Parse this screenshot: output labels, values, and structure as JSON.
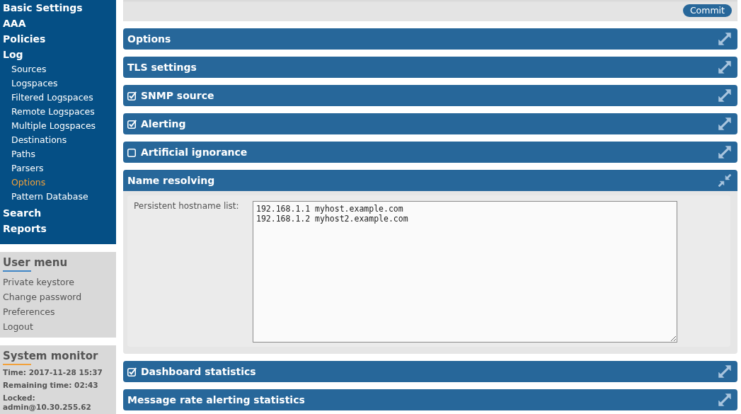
{
  "nav": {
    "items": [
      {
        "label": "Basic Settings",
        "selected": false
      },
      {
        "label": "AAA",
        "selected": false
      },
      {
        "label": "Policies",
        "selected": false
      },
      {
        "label": "Log",
        "selected": false,
        "children": [
          {
            "label": "Sources",
            "selected": false
          },
          {
            "label": "Logspaces",
            "selected": false
          },
          {
            "label": "Filtered Logspaces",
            "selected": false
          },
          {
            "label": "Remote Logspaces",
            "selected": false
          },
          {
            "label": "Multiple Logspaces",
            "selected": false
          },
          {
            "label": "Destinations",
            "selected": false
          },
          {
            "label": "Paths",
            "selected": false
          },
          {
            "label": "Parsers",
            "selected": false
          },
          {
            "label": "Options",
            "selected": true
          },
          {
            "label": "Pattern Database",
            "selected": false
          }
        ]
      },
      {
        "label": "Search",
        "selected": false
      },
      {
        "label": "Reports",
        "selected": false
      }
    ]
  },
  "user_menu": {
    "title": "User menu",
    "items": [
      "Private keystore",
      "Change password",
      "Preferences",
      "Logout"
    ]
  },
  "system_monitor": {
    "title": "System monitor",
    "items": [
      "Time: 2017-11-28 15:37",
      "Remaining time: 02:43",
      "Locked: admin@10.30.255.62"
    ]
  },
  "toolbar": {
    "button": "Commit"
  },
  "sections": [
    {
      "title": "Options",
      "kind": "plain",
      "expanded": false
    },
    {
      "title": "TLS settings",
      "kind": "plain",
      "expanded": false
    },
    {
      "title": "SNMP source",
      "kind": "checkbox",
      "checked": true,
      "expanded": false
    },
    {
      "title": "Alerting",
      "kind": "checkbox",
      "checked": true,
      "expanded": false
    },
    {
      "title": "Artificial ignorance",
      "kind": "checkbox",
      "checked": false,
      "expanded": false
    },
    {
      "title": "Name resolving",
      "kind": "plain",
      "expanded": true,
      "field": {
        "label": "Persistent hostname list:",
        "value": "192.168.1.1 myhost.example.com\n192.168.1.2 myhost2.example.com"
      }
    },
    {
      "title": "Dashboard statistics",
      "kind": "checkbox",
      "checked": true,
      "expanded": false
    },
    {
      "title": "Message rate alerting statistics",
      "kind": "plain",
      "expanded": false
    }
  ]
}
